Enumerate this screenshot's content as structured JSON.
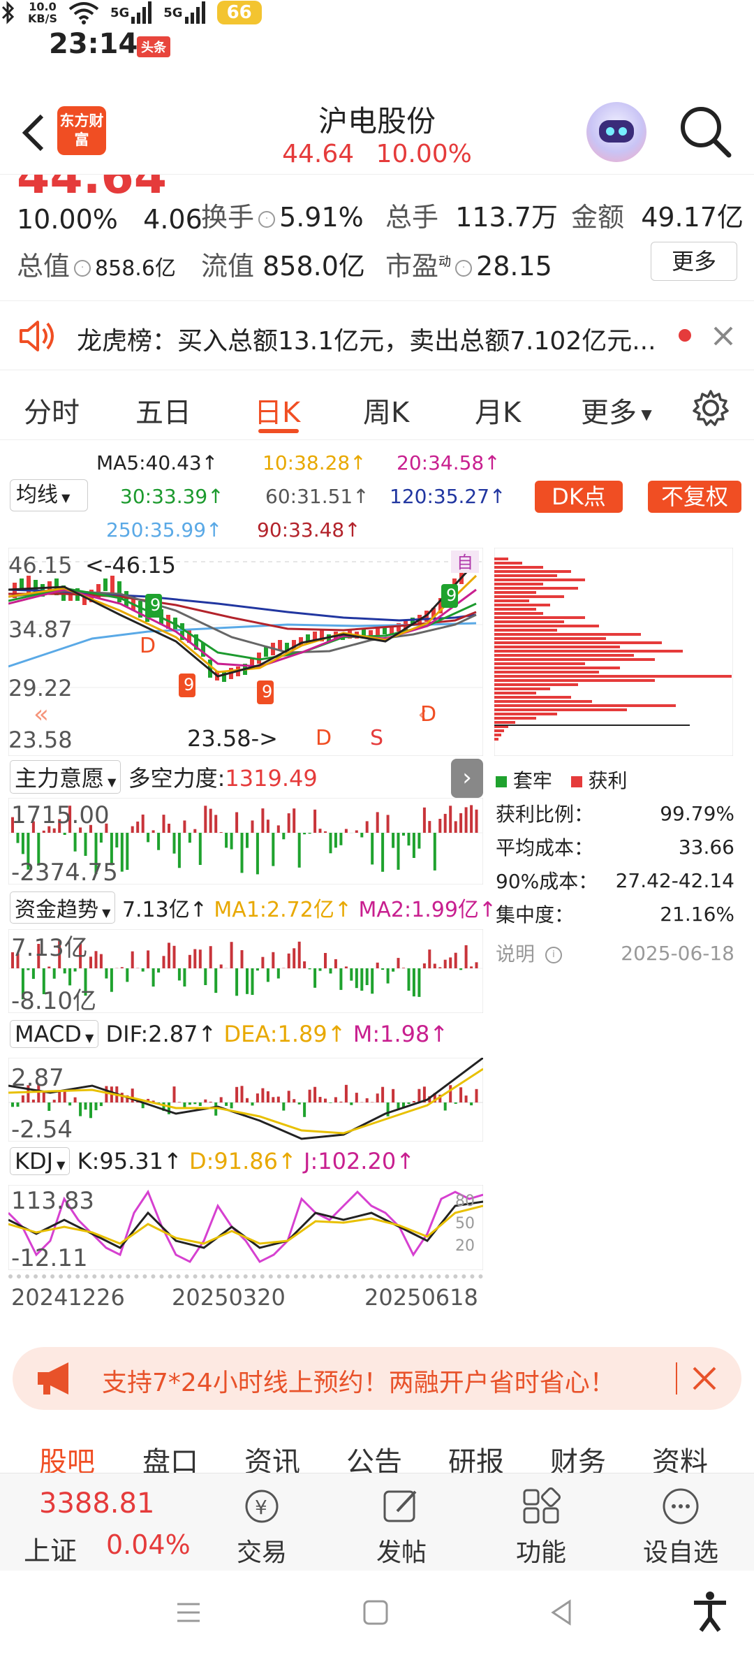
{
  "status_bar": {
    "time": "23:14",
    "app_badge": "头条",
    "speed": "10.0",
    "speed_unit": "KB/S",
    "network1": "5G",
    "network2": "5G",
    "battery": "66"
  },
  "header": {
    "logo_text": "东方财富",
    "title": "沪电股份",
    "price": "44.64",
    "change_pct": "10.00%"
  },
  "quote": {
    "price_partial": "44.64",
    "change_pct": "10.00%",
    "change_abs": "4.06",
    "turnover_label": "换手",
    "turnover_value": "5.91%",
    "volume_label": "总手",
    "volume_value": "113.7万",
    "amount_label": "金额",
    "amount_value": "49.17亿",
    "mktcap_label": "总值",
    "mktcap_value": "858.6亿",
    "float_label": "流值",
    "float_value": "858.0亿",
    "pe_label": "市盈",
    "pe_sup": "动",
    "pe_value": "28.15",
    "more_label": "更多"
  },
  "notice": {
    "text": "龙虎榜：买入总额13.1亿元，卖出总额7.102亿元...",
    "accent": "#e53b3b"
  },
  "tabs": [
    "分时",
    "五日",
    "日K",
    "周K",
    "月K",
    "更多"
  ],
  "active_tab": "日K",
  "ma_legend": {
    "selector": "均线",
    "ma5": "MA5:40.43↑",
    "ma10": "10:38.28↑",
    "ma20": "20:34.58↑",
    "ma30": "30:33.39↑",
    "ma60": "60:31.51↑",
    "ma120": "120:35.27↑",
    "ma250": "250:35.99↑",
    "ma90": "90:33.48↑",
    "dk_button": "DK点",
    "fuquan_button": "不复权"
  },
  "main_chart": {
    "y_labels": [
      "46.15",
      "34.87",
      "29.22",
      "23.58"
    ],
    "high_marker": "46.15",
    "low_marker": "23.58",
    "auto_label": "自",
    "d_marker": "D",
    "s_marker": "S"
  },
  "indicator1": {
    "selector": "主力意愿",
    "label": "多空力度:",
    "value": "1319.49",
    "y_top": "1715.00",
    "y_bottom": "-2374.75"
  },
  "indicator2": {
    "selector": "资金趋势",
    "value": "7.13亿↑",
    "ma1": "MA1:2.72亿↑",
    "ma2": "MA2:1.99亿↑",
    "y_top": "7.13亿",
    "y_bottom": "-8.10亿"
  },
  "macd": {
    "selector": "MACD",
    "dif": "DIF:2.87↑",
    "dea": "DEA:1.89↑",
    "m": "M:1.98↑",
    "y_top": "2.87",
    "y_bottom": "-2.54"
  },
  "kdj": {
    "selector": "KDJ",
    "k": "K:95.31↑",
    "d": "D:91.86↑",
    "j": "J:102.20↑",
    "y_top": "113.83",
    "y_bottom": "-12.11",
    "levels": [
      "80",
      "50",
      "20"
    ]
  },
  "dates": [
    "20241226",
    "20250320",
    "20250618"
  ],
  "chip": {
    "legend_trapped": "套牢",
    "legend_profit": "获利",
    "rows": [
      {
        "label": "获利比例：",
        "value": "99.79%"
      },
      {
        "label": "平均成本：",
        "value": "33.66"
      },
      {
        "label": "90%成本：",
        "value": "27.42-42.14"
      },
      {
        "label": "集中度：",
        "value": "21.16%"
      }
    ],
    "explain": "说明",
    "date": "2025-06-18"
  },
  "ad": {
    "text": "支持7*24小时线上预约！两融开户省时省心！"
  },
  "bottom_tabs": [
    "股吧",
    "盘口",
    "资讯",
    "公告",
    "研报",
    "财务",
    "资料"
  ],
  "bottom_nav": {
    "index_value": "3388.81",
    "index_name": "上证",
    "index_change": "0.04%",
    "trade": "交易",
    "post": "发帖",
    "functions": "功能",
    "watchlist": "设自选"
  }
}
